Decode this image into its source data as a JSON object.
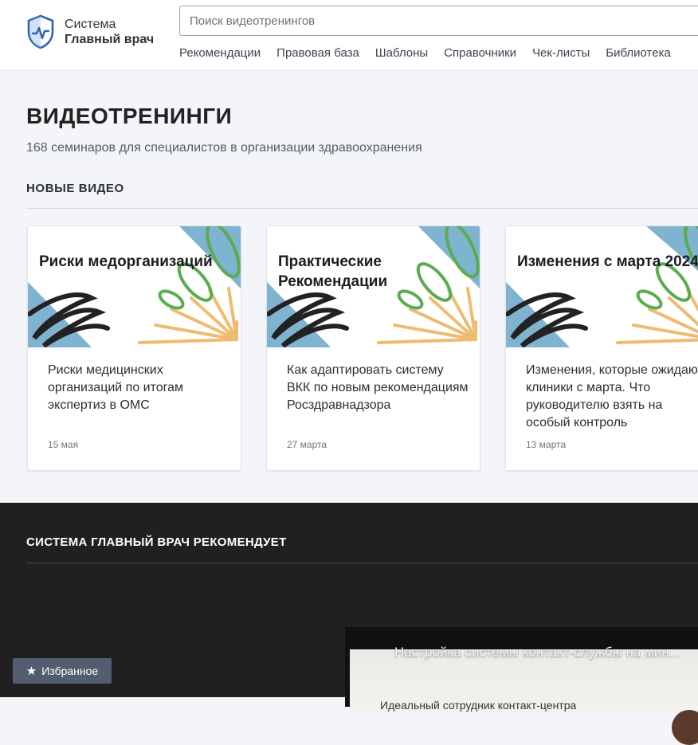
{
  "header": {
    "logo_line1": "Система",
    "logo_line2": "Главный врач",
    "search_placeholder": "Поиск видеотренингов",
    "nav": [
      "Рекомендации",
      "Правовая база",
      "Шаблоны",
      "Справочники",
      "Чек-листы",
      "Библиотека"
    ]
  },
  "main": {
    "title": "ВИДЕОТРЕНИНГИ",
    "subtitle": "168 семинаров для специалистов в организации здравоохранения",
    "section_label": "НОВЫЕ ВИДЕО",
    "cards": [
      {
        "banner_title": "Риски медорганизаций",
        "description": "Риски медицинских организаций по итогам экспертиз в ОМС",
        "date": "15 мая"
      },
      {
        "banner_title": "Практические Рекомендации",
        "description": "Как адаптировать систему ВКК по новым рекомендациям Росздравнадзора",
        "date": "27 марта"
      },
      {
        "banner_title": "Изменения с марта 2024",
        "description": "Изменения, которые ожидают клиники с марта. Что руководителю взять на особый контроль",
        "date": "13 марта"
      }
    ]
  },
  "recommend": {
    "title": "СИСТЕМА ГЛАВНЫЙ ВРАЧ РЕКОМЕНДУЕТ",
    "video_title": "Настройка системы контакт-службы на мин...",
    "video_subtitle": "Идеальный сотрудник контакт-центра"
  },
  "favorites_label": "Избранное",
  "colors": {
    "brand_blue": "#2d66b0",
    "banner_blue": "#7fb3cf",
    "banner_green": "#5aac50",
    "banner_orange": "#eebc70",
    "dark_bg": "#202020",
    "fav_button": "#545d70"
  },
  "icons": [
    "shield-pulse-logo-icon",
    "star-icon"
  ]
}
